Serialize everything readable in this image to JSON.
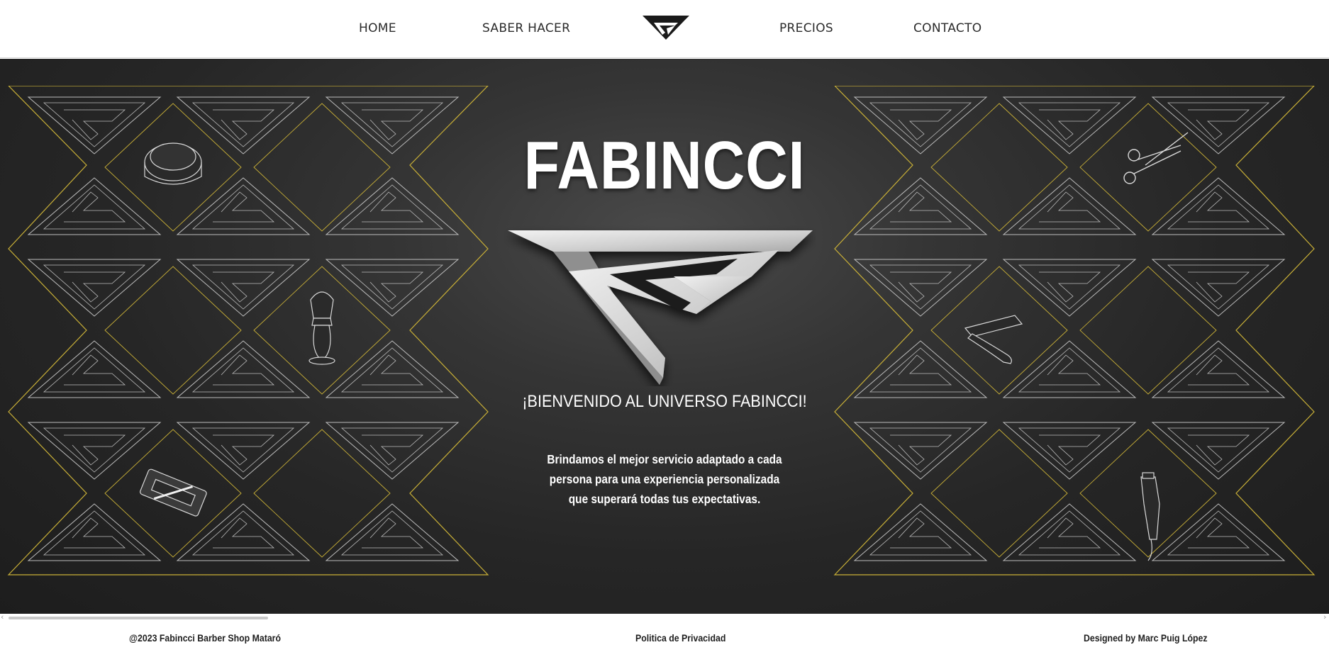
{
  "nav": {
    "links": [
      "HOME",
      "SABER HACER",
      "PRECIOS",
      "CONTACTO"
    ],
    "logo_icon": "fabincci-logo-icon"
  },
  "hero": {
    "title": "FABINCCI",
    "welcome": "¡BIENVENIDO AL UNIVERSO FABINCCI!",
    "tagline": [
      "Brindamos el mejor servicio adaptado a cada",
      "persona para una experiencia personalizada",
      "que superará todas tus expectativas."
    ],
    "decor_icons_left": [
      "pomade-tin-icon",
      "shaving-brush-icon",
      "razor-blade-icon"
    ],
    "decor_icons_right": [
      "scissors-icon",
      "straight-razor-icon",
      "hair-clipper-icon"
    ]
  },
  "footer": {
    "copyright": "@2023 Fabincci Barber Shop Mataró",
    "privacy": "Politica de Privacidad",
    "credit": "Designed by Marc Puig López"
  },
  "colors": {
    "background_dark": "#262626",
    "pattern_gold": "#c9b037",
    "pattern_silver": "#bdbdbd",
    "text_light": "#ffffff"
  }
}
